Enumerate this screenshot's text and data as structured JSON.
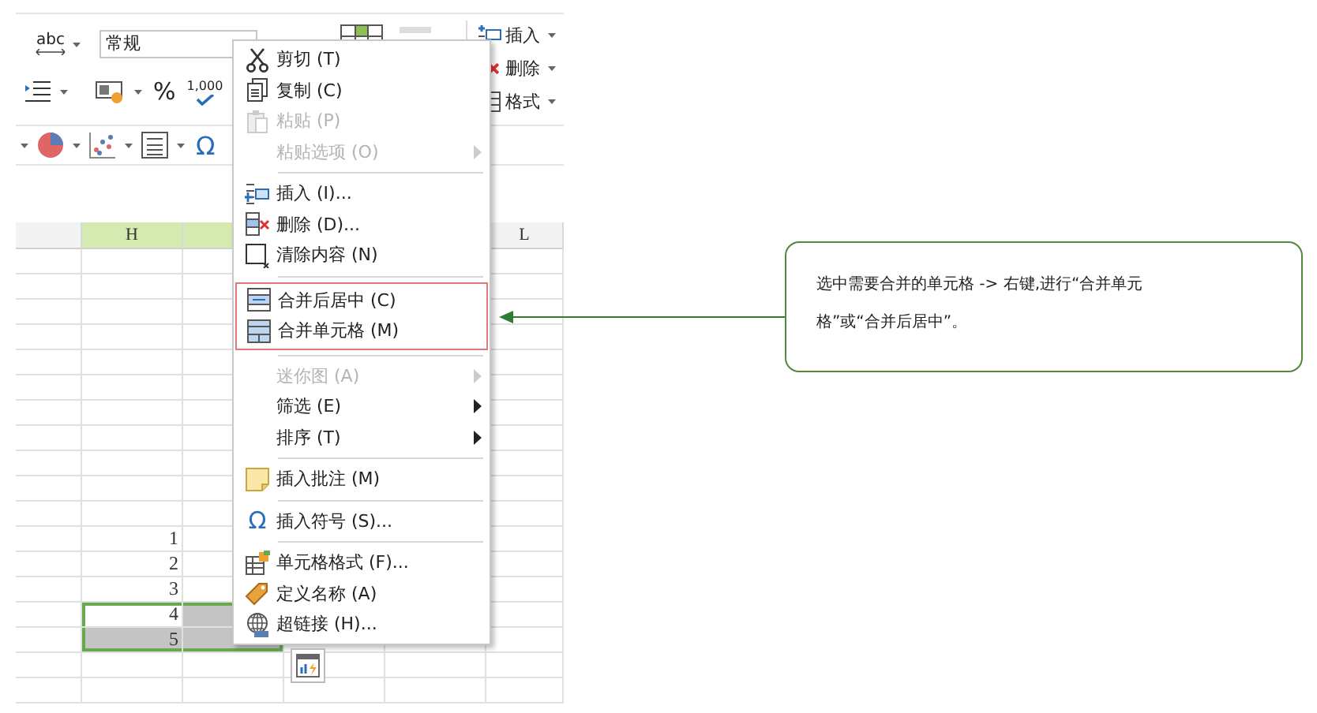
{
  "ribbon": {
    "wrap_label": "abc",
    "number_format": {
      "value": "常规"
    },
    "percent": "%",
    "thousands": "1,000",
    "cells_buttons": [
      {
        "label": "插入"
      },
      {
        "label": "删除"
      },
      {
        "label": "格式"
      }
    ],
    "symbol": "Ω"
  },
  "sheet": {
    "columns": [
      {
        "selected": false
      },
      {
        "label": "H",
        "selected": true
      },
      {
        "selected": true
      },
      {
        "label": "L",
        "selected": false
      }
    ],
    "rows": [
      {
        "selected": false
      },
      {
        "selected": false
      },
      {
        "selected": false
      },
      {
        "selected": false
      },
      {
        "selected": false
      },
      {
        "selected": false
      },
      {
        "selected": false
      },
      {
        "selected": false
      },
      {
        "selected": false
      },
      {
        "selected": false
      },
      {
        "selected": false
      },
      {
        "selected": false,
        "h": "1"
      },
      {
        "selected": false,
        "h": "2"
      },
      {
        "selected": false,
        "h": "3"
      },
      {
        "selected": true,
        "active": true,
        "h": "4"
      },
      {
        "selected": true,
        "active": false,
        "h": "5"
      },
      {
        "selected": false
      },
      {
        "selected": false
      }
    ]
  },
  "context_menu": {
    "groups": [
      {
        "highlighted": false,
        "items": [
          {
            "label": "剪切 (T)",
            "disabled": false,
            "submenu": false
          },
          {
            "label": "复制 (C)",
            "disabled": false,
            "submenu": false
          },
          {
            "label": "粘贴 (P)",
            "disabled": true,
            "submenu": false
          },
          {
            "label": "粘贴选项 (O)",
            "disabled": true,
            "submenu": true
          }
        ]
      },
      {
        "highlighted": false,
        "items": [
          {
            "label": "插入 (I)...",
            "disabled": false,
            "submenu": false
          },
          {
            "label": "删除 (D)...",
            "disabled": false,
            "submenu": false
          },
          {
            "label": "清除内容 (N)",
            "disabled": false,
            "submenu": false
          }
        ]
      },
      {
        "highlighted": true,
        "items": [
          {
            "label": "合并后居中 (C)",
            "disabled": false,
            "submenu": false
          },
          {
            "label": "合并单元格 (M)",
            "disabled": false,
            "submenu": false
          }
        ]
      },
      {
        "highlighted": false,
        "items": [
          {
            "label": "迷你图 (A)",
            "disabled": true,
            "submenu": true
          },
          {
            "label": "筛选 (E)",
            "disabled": false,
            "submenu": true
          },
          {
            "label": "排序 (T)",
            "disabled": false,
            "submenu": true
          }
        ]
      },
      {
        "highlighted": false,
        "items": [
          {
            "label": "插入批注 (M)",
            "disabled": false,
            "submenu": false
          }
        ]
      },
      {
        "highlighted": false,
        "items": [
          {
            "label": "插入符号 (S)...",
            "disabled": false,
            "submenu": false,
            "glyph": "Ω"
          }
        ]
      },
      {
        "highlighted": false,
        "items": [
          {
            "label": "单元格格式 (F)...",
            "disabled": false,
            "submenu": false
          },
          {
            "label": "定义名称 (A)",
            "disabled": false,
            "submenu": false
          },
          {
            "label": "超链接 (H)...",
            "disabled": false,
            "submenu": false
          }
        ]
      }
    ]
  },
  "callout": {
    "text": "选中需要合并的单元格 -> 右键,进行“合并单元格”或“合并后居中”。"
  }
}
